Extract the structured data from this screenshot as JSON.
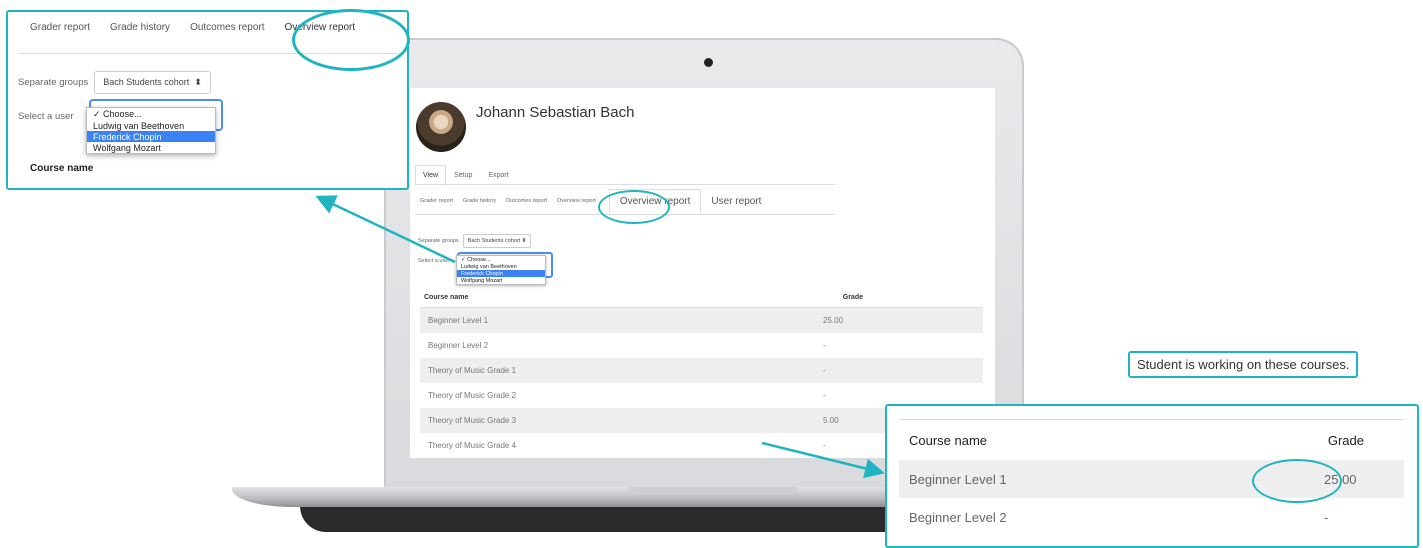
{
  "user": {
    "name": "Johann Sebastian Bach"
  },
  "top_tabs": [
    "View",
    "Setup",
    "Export"
  ],
  "report_tabs": [
    "Grader report",
    "Grade history",
    "Outcomes report",
    "Overview report"
  ],
  "report_tabs_extra": [
    "Overview report",
    "User report"
  ],
  "groups": {
    "label": "Separate groups",
    "value": "Bach Students cohort"
  },
  "select_user": {
    "label": "Select a user",
    "options": [
      "Choose...",
      "Ludwig van Beethoven",
      "Frederick Chopin",
      "Wolfgang Mozart"
    ],
    "selected_mark": "✓",
    "highlighted": "Frederick Chopin"
  },
  "table": {
    "headers": {
      "course": "Course name",
      "grade": "Grade"
    },
    "rows": [
      {
        "course": "Beginner Level 1",
        "grade": "25.00"
      },
      {
        "course": "Beginner Level 2",
        "grade": "-"
      },
      {
        "course": "Theory of Music Grade 1",
        "grade": "-"
      },
      {
        "course": "Theory of Music Grade 2",
        "grade": "-"
      },
      {
        "course": "Theory of Music Grade 3",
        "grade": "5.00"
      },
      {
        "course": "Theory of Music Grade 4",
        "grade": "-"
      }
    ]
  },
  "callout_top": {
    "tabs": [
      "Grader report",
      "Grade history",
      "Outcomes report",
      "Overview report"
    ],
    "groups_label": "Separate groups",
    "groups_value": "Bach Students cohort",
    "select_label": "Select a user",
    "options": [
      "Choose...",
      "Ludwig van Beethoven",
      "Frederick Chopin",
      "Wolfgang Mozart"
    ],
    "course_header": "Course name"
  },
  "callout_bottom": {
    "note": "Student is working on these courses.",
    "headers": {
      "course": "Course name",
      "grade": "Grade"
    },
    "rows": [
      {
        "course": "Beginner Level 1",
        "grade": "25.00"
      },
      {
        "course": "Beginner Level 2",
        "grade": "-"
      }
    ]
  },
  "colors": {
    "accent": "#1fb5c0",
    "highlight": "#3b82f6",
    "row_alt": "#eeeeee"
  }
}
